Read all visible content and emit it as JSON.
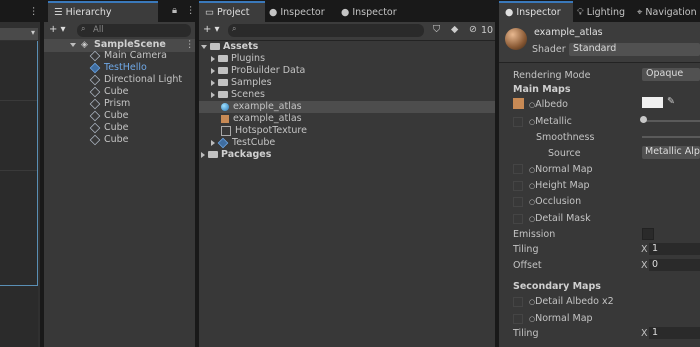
{
  "hierarchy": {
    "tab": "Hierarchy",
    "add_label": "+ ▾",
    "search_placeholder": "All",
    "scene": "SampleScene",
    "items": [
      "Main Camera",
      "TestHello",
      "Directional Light",
      "Cube",
      "Prism",
      "Cube",
      "Cube",
      "Cube"
    ]
  },
  "project": {
    "tabs": [
      "Project",
      "Inspector",
      "Inspector"
    ],
    "add_label": "+ ▾",
    "count": "10",
    "assets_root": "Assets",
    "items": [
      "Plugins",
      "ProBuilder Data",
      "Samples",
      "Scenes",
      "example_atlas",
      "example_atlas",
      "HotspotTexture",
      "TestCube"
    ],
    "packages": "Packages"
  },
  "inspector": {
    "tabs": [
      "Inspector",
      "Lighting",
      "Navigation"
    ],
    "material_name": "example_atlas",
    "shader_label": "Shader",
    "shader_value": "Standard",
    "rendering_mode_label": "Rendering Mode",
    "rendering_mode_value": "Opaque",
    "main_maps": "Main Maps",
    "albedo": "Albedo",
    "metallic": "Metallic",
    "smoothness": "Smoothness",
    "source_label": "Source",
    "source_value": "Metallic Alph",
    "normal_map": "Normal Map",
    "height_map": "Height Map",
    "occlusion": "Occlusion",
    "detail_mask": "Detail Mask",
    "emission": "Emission",
    "tiling": "Tiling",
    "offset": "Offset",
    "x_label": "X",
    "tiling_x": "1",
    "offset_x": "0",
    "secondary_maps": "Secondary Maps",
    "detail_albedo": "Detail Albedo x2",
    "normal_map_2": "Normal Map",
    "tiling_2": "Tiling",
    "tiling_x_2": "1"
  },
  "colors": {
    "accent": "#3a79bb",
    "panel": "#383838",
    "selected_blue": "#4c8fd6"
  }
}
